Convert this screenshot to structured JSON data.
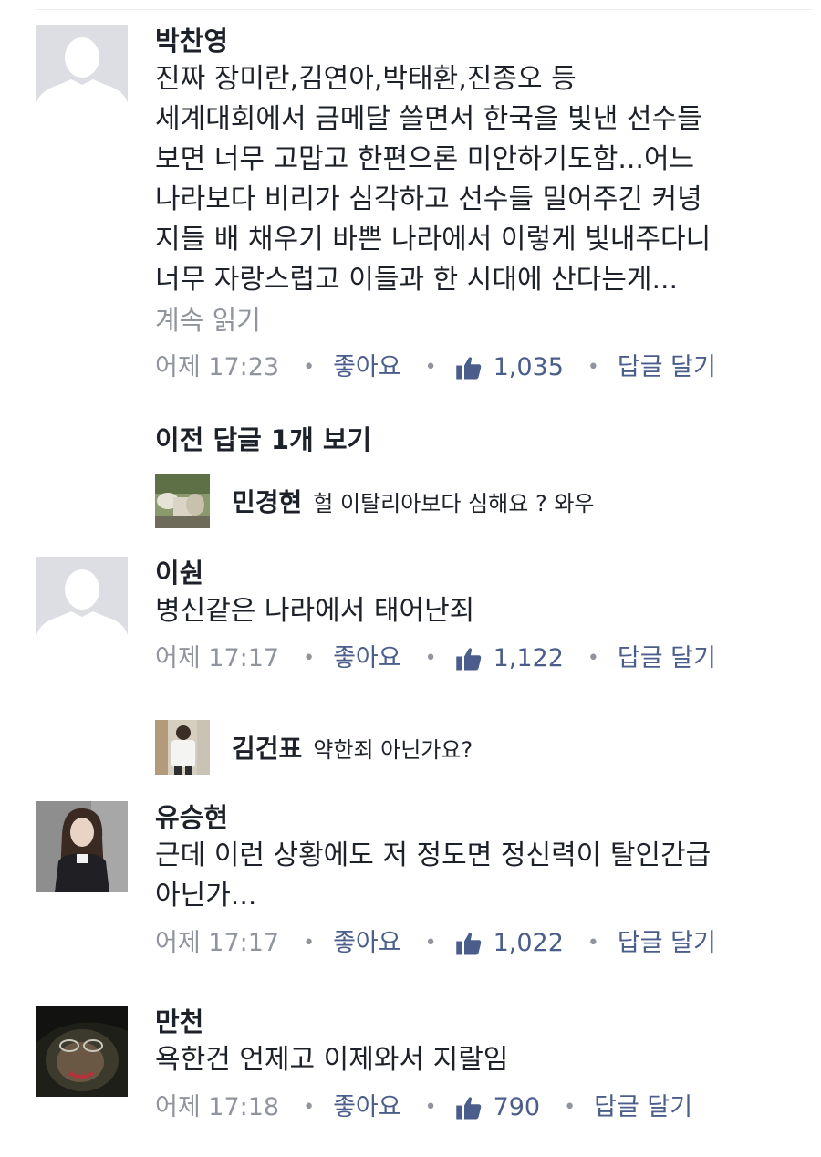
{
  "comments": [
    {
      "author": "박찬영",
      "lines": [
        "진짜 장미란,김연아,박태환,진종오 등",
        "세계대회에서 금메달 쓸면서 한국을 빛낸 선수들",
        "보면 너무 고맙고 한편으론 미안하기도함...어느",
        "나라보다 비리가 심각하고 선수들 밀어주긴 커녕",
        "지들 배 채우기 바쁜 나라에서 이렇게 빛내주다니",
        "너무 자랑스럽고 이들과 한 시대에 산다는게..."
      ],
      "see_more": "계속 읽기",
      "time": "어제 17:23",
      "like_label": "좋아요",
      "likes": "1,035",
      "reply_label": "답글 달기"
    },
    {
      "author": "이숸",
      "lines": [
        "병신같은 나라에서 태어난죄"
      ],
      "time": "어제 17:17",
      "like_label": "좋아요",
      "likes": "1,122",
      "reply_label": "답글 달기"
    },
    {
      "author": "유승현",
      "lines": [
        "근데 이런 상황에도 저 정도면 정신력이 탈인간급",
        "아닌가..."
      ],
      "time": "어제 17:17",
      "like_label": "좋아요",
      "likes": "1,022",
      "reply_label": "답글 달기"
    },
    {
      "author": "만천",
      "lines": [
        "욕한건 언제고 이제와서 지랄임"
      ],
      "time": "어제 17:18",
      "like_label": "좋아요",
      "likes": "790",
      "reply_label": "답글 달기"
    }
  ],
  "previous_replies_label": "이전 답글 1개 보기",
  "replies": [
    {
      "author": "민경현",
      "text": "헐 이탈리아보다 심해요 ? 와우"
    },
    {
      "author": "김건표",
      "text": "약한죄 아닌가요?"
    }
  ],
  "separator": "•",
  "icons": {
    "like": "thumbs-up-icon",
    "default_avatar": "default-avatar-icon"
  },
  "colors": {
    "link": "#4b5e8b",
    "meta": "#90949c",
    "text": "#1d2129"
  }
}
